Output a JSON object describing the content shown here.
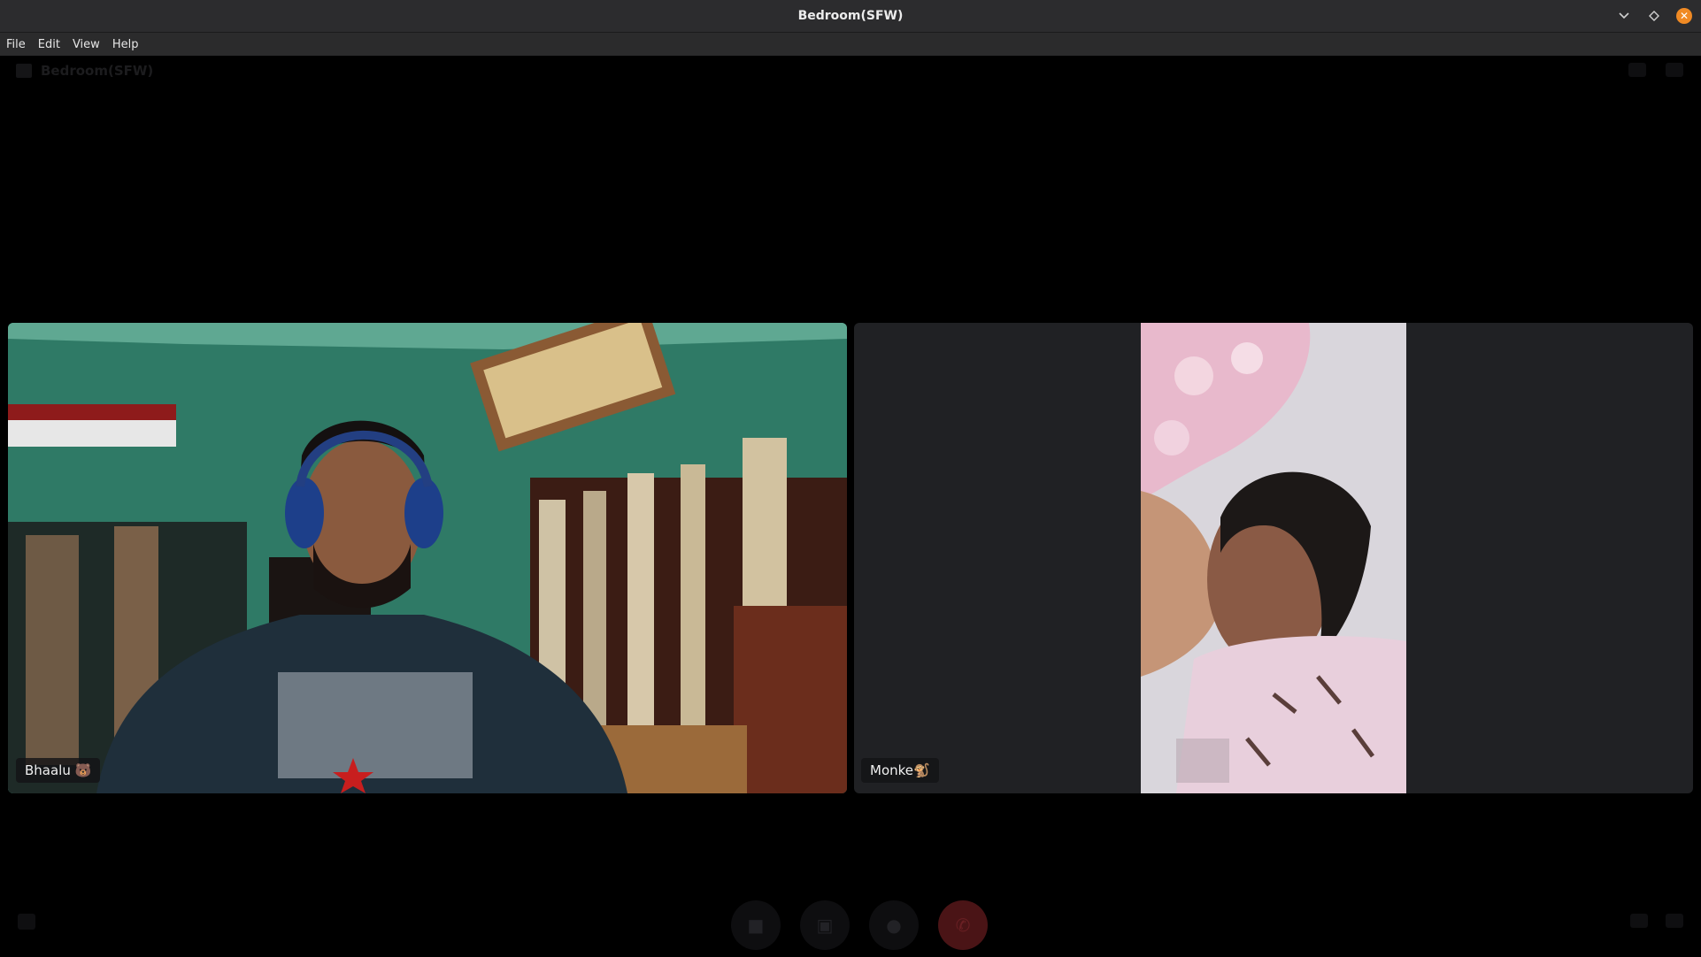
{
  "window": {
    "title": "Bedroom(SFW)"
  },
  "wm_controls": {
    "minimize_icon": "chevron-down-icon",
    "maximize_icon": "diamond-icon",
    "close_icon": "close-icon"
  },
  "menu": {
    "items": [
      "File",
      "Edit",
      "View",
      "Help"
    ]
  },
  "call": {
    "header_title": "Bedroom(SFW)",
    "participants": [
      {
        "name": "Bhaalu 🐻"
      },
      {
        "name": "Monke🐒"
      }
    ],
    "controls": [
      {
        "icon": "camera-icon"
      },
      {
        "icon": "screen-share-icon"
      },
      {
        "icon": "microphone-icon"
      },
      {
        "icon": "hang-up-icon"
      }
    ]
  }
}
